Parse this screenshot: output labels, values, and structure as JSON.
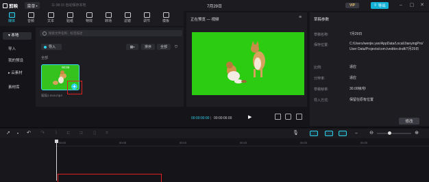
{
  "titlebar": {
    "app_name": "剪映",
    "menu_label": "菜单",
    "autosave": "11:38:15 自动保存本地",
    "project_title": "7月29日",
    "vip_label": "VIP",
    "export_label": "导出"
  },
  "toolbar": {
    "items": [
      {
        "label": "媒体",
        "icon": "media-icon"
      },
      {
        "label": "音频",
        "icon": "audio-icon"
      },
      {
        "label": "文本",
        "icon": "text-icon"
      },
      {
        "label": "贴纸",
        "icon": "sticker-icon"
      },
      {
        "label": "特效",
        "icon": "effects-icon"
      },
      {
        "label": "转场",
        "icon": "transition-icon"
      },
      {
        "label": "滤镜",
        "icon": "filter-icon"
      },
      {
        "label": "调节",
        "icon": "adjust-icon"
      },
      {
        "label": "模板",
        "icon": "template-icon"
      }
    ]
  },
  "sidebar": {
    "items": [
      "▾ 本地",
      "导入",
      "我的预设",
      "▸ 云素材",
      "素材库"
    ]
  },
  "media": {
    "search_placeholder": "搜索文件名称、标签描述",
    "import_label": "导入",
    "sort_label": "排序",
    "filter_label": "全部",
    "all_label": "全部",
    "clip_duration": "00:06",
    "clip_name": "猫猫1.mov.mp4"
  },
  "preview": {
    "title": "正在预览 — 视频",
    "time_current": "00:00:00:00",
    "time_total": "00:00:06:00"
  },
  "properties": {
    "title": "草稿参数",
    "rows": [
      {
        "label": "草稿名称:",
        "value": "7月29日"
      },
      {
        "label": "保存位置:",
        "value": "C:/Users/wenjie.yan/AppData/Local/JianyingPro/User Data/Projects/com.lveditor.draft/7月29日"
      },
      {
        "label": "比例:",
        "value": "适应"
      },
      {
        "label": "分辨率:",
        "value": "适应"
      },
      {
        "label": "草稿帧率:",
        "value": "30.00帧/秒"
      },
      {
        "label": "导入方式:",
        "value": "保留在原有位置"
      }
    ],
    "modify_label": "修改"
  },
  "timeline": {
    "ticks": [
      "00:00",
      "00:05",
      "00:10",
      "00:15",
      "00:20",
      "00:25"
    ]
  },
  "colors": {
    "accent": "#2fd3f0",
    "highlight_box": "#e02020",
    "green_screen": "#2ccc12"
  }
}
